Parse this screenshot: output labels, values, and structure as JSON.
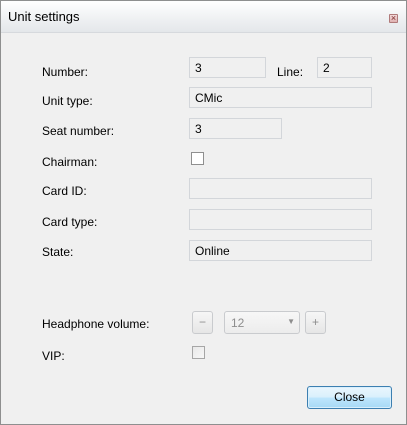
{
  "window": {
    "title": "Unit settings",
    "close_glyph": "×"
  },
  "form": {
    "number": {
      "label": "Number:",
      "value": "3"
    },
    "line": {
      "label": "Line:",
      "value": "2"
    },
    "unit_type": {
      "label": "Unit type:",
      "value": "CMic"
    },
    "seat_number": {
      "label": "Seat number:",
      "value": "3"
    },
    "chairman": {
      "label": "Chairman:",
      "checked": false
    },
    "card_id": {
      "label": "Card ID:",
      "value": ""
    },
    "card_type": {
      "label": "Card type:",
      "value": ""
    },
    "state": {
      "label": "State:",
      "value": "Online"
    },
    "headphone_volume": {
      "label": "Headphone volume:",
      "value": "12",
      "minus": "−",
      "plus": "+",
      "arrow": "▼"
    },
    "vip": {
      "label": "VIP:",
      "checked": false,
      "disabled": true
    }
  },
  "buttons": {
    "close_label": "Close"
  }
}
